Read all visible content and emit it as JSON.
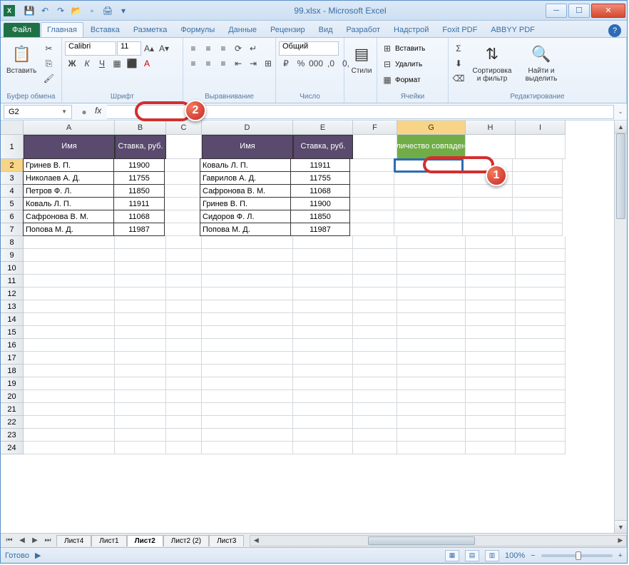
{
  "title": "99.xlsx - Microsoft Excel",
  "qat_tips": [
    "save",
    "undo",
    "redo",
    "open",
    "new",
    "print",
    "quick-print"
  ],
  "tabs": {
    "file": "Файл",
    "list": [
      "Главная",
      "Вставка",
      "Разметка",
      "Формулы",
      "Данные",
      "Рецензир",
      "Вид",
      "Разработ",
      "Надстрой",
      "Foxit PDF",
      "ABBYY PDF"
    ],
    "active": 0
  },
  "ribbon": {
    "clipboard": {
      "paste": "Вставить",
      "label": "Буфер обмена"
    },
    "font": {
      "name": "Calibri",
      "size": "11",
      "label": "Шрифт"
    },
    "align": {
      "label": "Выравнивание"
    },
    "number": {
      "format": "Общий",
      "label": "Число"
    },
    "styles": {
      "btn": "Стили",
      "label": ""
    },
    "cells": {
      "insert": "Вставить",
      "delete": "Удалить",
      "format": "Формат",
      "label": "Ячейки"
    },
    "editing": {
      "sort": "Сортировка и фильтр",
      "find": "Найти и выделить",
      "label": "Редактирование"
    }
  },
  "fbar": {
    "name": "G2",
    "fx": "fx",
    "value": ""
  },
  "columns": [
    "A",
    "B",
    "C",
    "D",
    "E",
    "F",
    "G",
    "H",
    "I"
  ],
  "row_count": 24,
  "headers": {
    "A": "Имя",
    "B": "Ставка, руб.",
    "D": "Имя",
    "E": "Ставка, руб.",
    "G": "Количество совпадений"
  },
  "table1": [
    {
      "name": "Гринев В. П.",
      "rate": "11900"
    },
    {
      "name": "Николаев А. Д.",
      "rate": "11755"
    },
    {
      "name": "Петров Ф. Л.",
      "rate": "11850"
    },
    {
      "name": "Коваль Л. П.",
      "rate": "11911"
    },
    {
      "name": "Сафронова В. М.",
      "rate": "11068"
    },
    {
      "name": "Попова М. Д.",
      "rate": "11987"
    }
  ],
  "table2": [
    {
      "name": "Коваль Л. П.",
      "rate": "11911"
    },
    {
      "name": "Гаврилов А. Д.",
      "rate": "11755"
    },
    {
      "name": "Сафронова В. М.",
      "rate": "11068"
    },
    {
      "name": "Гринев В. П.",
      "rate": "11900"
    },
    {
      "name": "Сидоров Ф. Л.",
      "rate": "11850"
    },
    {
      "name": "Попова М. Д.",
      "rate": "11987"
    }
  ],
  "selected_cell": "G2",
  "sheets": {
    "list": [
      "Лист4",
      "Лист1",
      "Лист2",
      "Лист2 (2)",
      "Лист3"
    ],
    "active": 2
  },
  "status": {
    "ready": "Готово",
    "zoom": "100%"
  },
  "markers": {
    "m1": "1",
    "m2": "2"
  }
}
